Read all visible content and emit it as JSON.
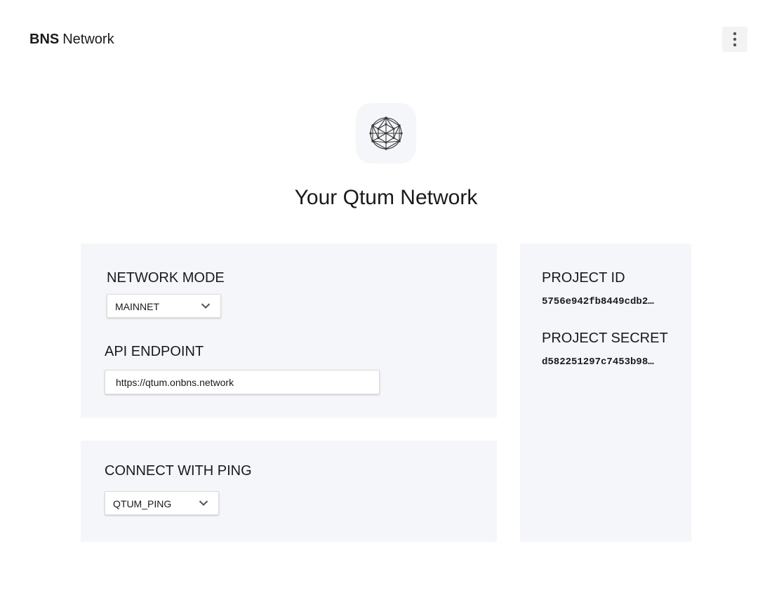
{
  "header": {
    "brand_bold": "BNS",
    "brand_regular": "Network",
    "menu_icon": "more-vertical-icon"
  },
  "hero": {
    "logo_icon": "qtum-network-icon",
    "title": "Your Qtum Network"
  },
  "network_card": {
    "mode_label": "NETWORK MODE",
    "mode_value": "MAINNET",
    "endpoint_label": "API ENDPOINT",
    "endpoint_value": "https://qtum.onbns.network"
  },
  "ping_card": {
    "label": "CONNECT WITH PING",
    "value": "QTUM_PING"
  },
  "project_card": {
    "id_label": "PROJECT ID",
    "id_value": "5756e942fb8449cdb2…",
    "secret_label": "PROJECT SECRET",
    "secret_value": "d582251297c7453b98…"
  },
  "colors": {
    "card_background": "#f5f6fa",
    "menu_button_background": "#f3f3f3",
    "text": "#1a1a1a"
  }
}
